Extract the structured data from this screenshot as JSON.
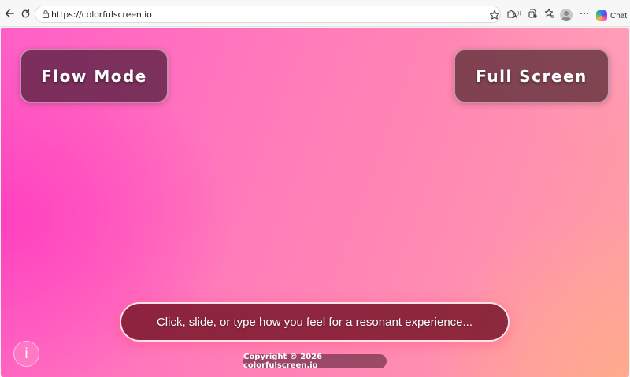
{
  "browser": {
    "url": "https://colorfulscreen.io",
    "chat_label": "Chat",
    "icons": [
      "back-icon",
      "refresh-icon",
      "lock-icon",
      "read-aloud-icon",
      "favorite-star-icon",
      "extensions-icon",
      "browser-essentials-icon",
      "favorites-icon",
      "profile-avatar",
      "more-icon",
      "copilot-icon"
    ]
  },
  "page": {
    "flow_mode_label": "Flow Mode",
    "full_screen_label": "Full Screen",
    "prompt_text": "Click, slide, or type how you feel for a resonant experience...",
    "info_label": "i",
    "copyright": "Copyright © 2026 colorfulscreen.io"
  },
  "colors": {
    "gradient_pink": "#ff5ec7",
    "gradient_peach": "#ffa3a0",
    "button_bg": "#5f2346",
    "prompt_bg": "#7d192d"
  }
}
